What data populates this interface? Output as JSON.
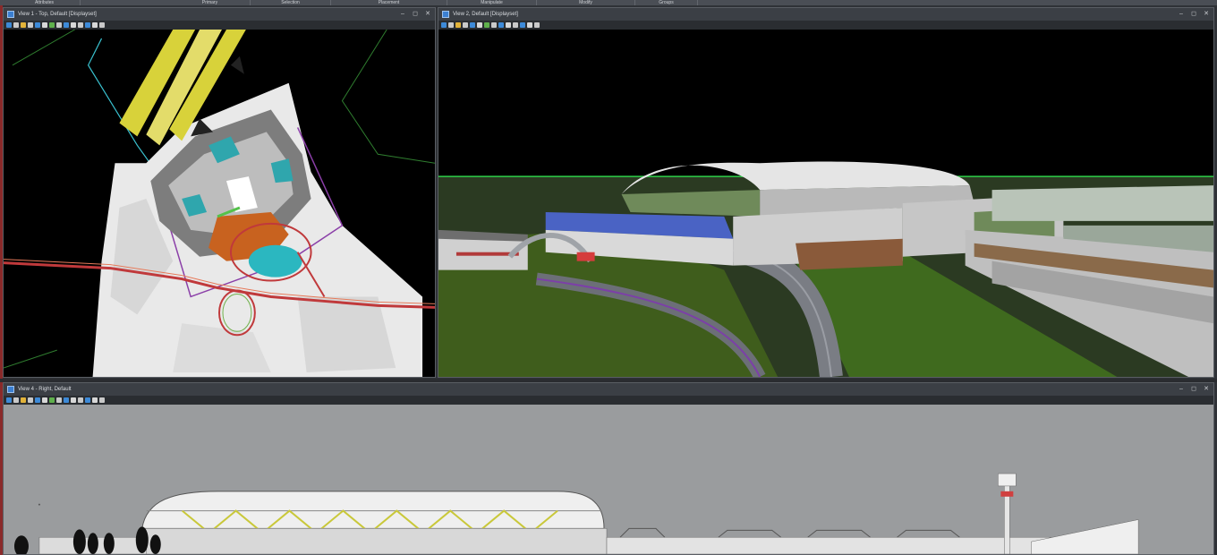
{
  "ribbon": {
    "tabs": [
      "Attributes",
      "Primary",
      "Selection",
      "Placement",
      "Manipulate",
      "Modify",
      "Groups"
    ]
  },
  "views": {
    "view1": {
      "title": "View 1 - Top, Default [Displayset]"
    },
    "view2": {
      "title": "View 2, Default [Displayset]"
    },
    "view4": {
      "title": "View 4 - Right, Default"
    }
  },
  "window_buttons": {
    "minimize": "–",
    "maximize": "◻",
    "close": "✕"
  },
  "icons": [
    "view-icon",
    "toolbar-tool-icon",
    "minimize-icon",
    "maximize-icon",
    "close-icon"
  ],
  "colors": {
    "title_bar": "#3b3f45",
    "viewport_bg": "#000000",
    "sky_gray": "#9a9c9e",
    "grass": "#3f5d1c",
    "road_red": "#c0393b",
    "runway_yellow": "#d8d23a",
    "water_cyan": "#2bb7c0"
  }
}
